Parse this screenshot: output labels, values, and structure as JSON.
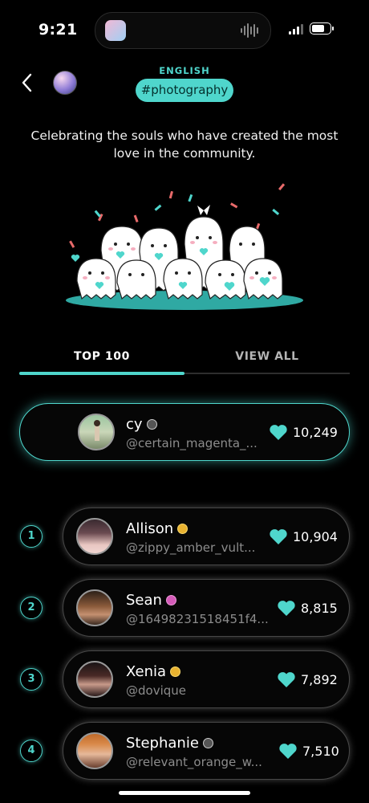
{
  "status_bar": {
    "time": "9:21"
  },
  "header": {
    "language": "ENGLISH",
    "tag": "#photography",
    "description": "Celebrating the souls who have created the most love in the community."
  },
  "tabs": [
    {
      "label": "TOP 100",
      "active": true
    },
    {
      "label": "VIEW ALL",
      "active": false
    }
  ],
  "current_user": {
    "name": "cy",
    "handle": "@certain_magenta_...",
    "score": "10,249",
    "badge_color": "#555555"
  },
  "leaderboard": [
    {
      "rank": "1",
      "name": "Allison",
      "handle": "@zippy_amber_vult...",
      "score": "10,904",
      "badge_color": "#e8b230"
    },
    {
      "rank": "2",
      "name": "Sean",
      "handle": "@16498231518451f4...",
      "score": "8,815",
      "badge_color": "#d45ab8"
    },
    {
      "rank": "3",
      "name": "Xenia",
      "handle": "@dovique",
      "score": "7,892",
      "badge_color": "#e8b230"
    },
    {
      "rank": "4",
      "name": "Stephanie",
      "handle": "@relevant_orange_w...",
      "score": "7,510",
      "badge_color": "#555555"
    }
  ],
  "colors": {
    "accent": "#4fd6cc",
    "background": "#000000"
  }
}
